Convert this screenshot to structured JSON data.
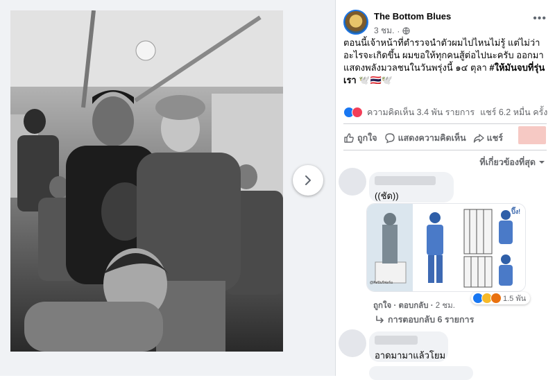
{
  "post": {
    "page_name": "The Bottom Blues",
    "time": "3 ชม.",
    "text_main": "ตอนนี้เจ้าหน้าที่ตำรวจนำตัวผมไปไหนไม่รู้ แต่ไม่ว่าอะไรจะเกิดขึ้น ผมขอให้ทุกคนสู้ต่อไปนะครับ ออกมาแสดงพลังมวลชนในวันพรุ่งนี้ ๑๔ ตุลา ",
    "text_hashtag": "#ให้มันจบที่รุ่นเรา",
    "text_emoji": " 🕊️🇹🇭🕊️"
  },
  "stats": {
    "comments": "ความคิดเห็น 3.4 พัน รายการ",
    "shares": "แชร์ 6.2 หมื่น ครั้ง"
  },
  "actions": {
    "like": "ถูกใจ",
    "comment": "แสดงความคิดเห็น",
    "share": "แชร์"
  },
  "comments": {
    "sort_label": "ที่เกี่ยวข้องที่สุด",
    "first": {
      "text": "((ชัด))",
      "like": "ถูกใจ",
      "reply": "ตอบกลับ",
      "time": "2 ชม.",
      "reaction_count": "1.5 พัน",
      "replies": "การตอบกลับ 6 รายการ"
    },
    "second": {
      "text": "อาดมามาแล้วโยม"
    }
  },
  "sticker": {
    "caption_1": "@ศิลปินรีฟอร์ม",
    "caption_2": "ปิ๊ง!"
  },
  "colors": {
    "accent": "#1b74e4",
    "muted": "#65676b",
    "redacted": "#f6c9c4"
  },
  "icons": [
    "chevron-right-icon",
    "globe-icon",
    "more-icon",
    "like-icon",
    "comment-icon",
    "share-icon",
    "caret-down-icon",
    "reply-arrow-icon"
  ]
}
